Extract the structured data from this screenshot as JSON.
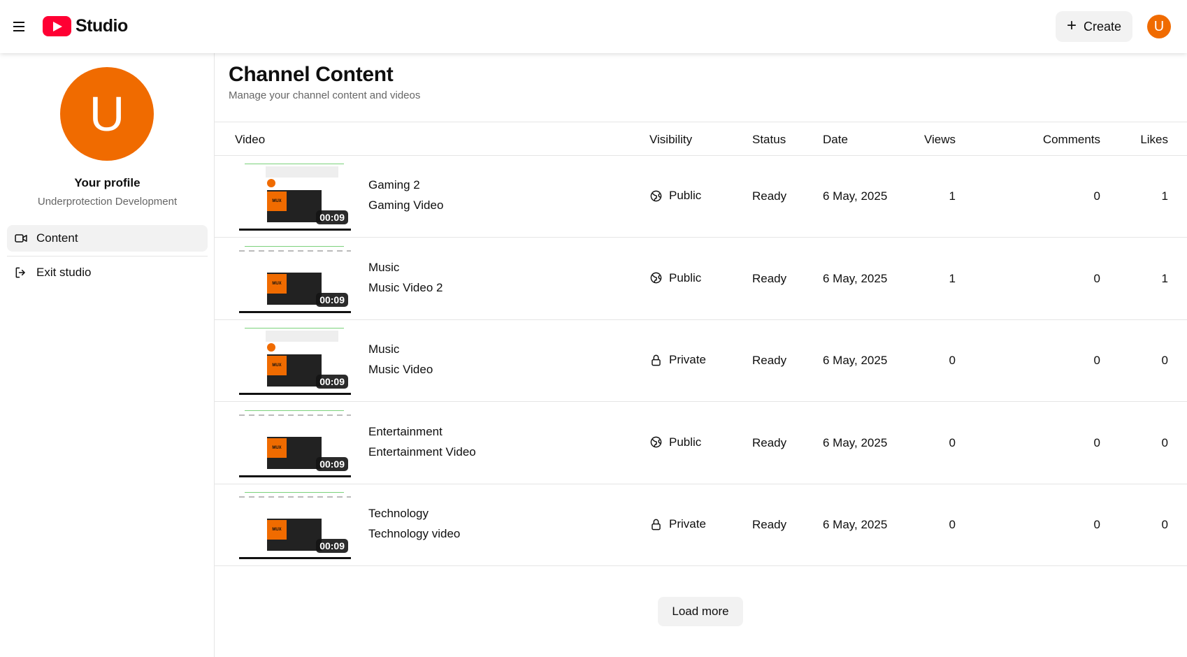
{
  "header": {
    "menu_icon": "hamburger-icon",
    "logo_text": "Studio",
    "create_label": "Create",
    "avatar_initial": "U"
  },
  "sidebar": {
    "avatar_initial": "U",
    "profile_title": "Your profile",
    "profile_name": "Underprotection Development",
    "items": [
      {
        "label": "Content",
        "icon": "video-camera-icon",
        "active": true
      },
      {
        "label": "Exit studio",
        "icon": "logout-icon",
        "active": false
      }
    ]
  },
  "main": {
    "title": "Channel Content",
    "subtitle": "Manage your channel content and videos",
    "columns": {
      "video": "Video",
      "visibility": "Visibility",
      "status": "Status",
      "date": "Date",
      "views": "Views",
      "comments": "Comments",
      "likes": "Likes"
    },
    "rows": [
      {
        "line1": "Gaming 2",
        "line2": "Gaming Video",
        "duration": "00:09",
        "visibility": "Public",
        "status": "Ready",
        "date": "6 May, 2025",
        "views": "1",
        "comments": "0",
        "likes": "1"
      },
      {
        "line1": "Music",
        "line2": "Music Video 2",
        "duration": "00:09",
        "visibility": "Public",
        "status": "Ready",
        "date": "6 May, 2025",
        "views": "1",
        "comments": "0",
        "likes": "1"
      },
      {
        "line1": "Music",
        "line2": "Music Video",
        "duration": "00:09",
        "visibility": "Private",
        "status": "Ready",
        "date": "6 May, 2025",
        "views": "0",
        "comments": "0",
        "likes": "0"
      },
      {
        "line1": "Entertainment",
        "line2": "Entertainment Video",
        "duration": "00:09",
        "visibility": "Public",
        "status": "Ready",
        "date": "6 May, 2025",
        "views": "0",
        "comments": "0",
        "likes": "0"
      },
      {
        "line1": "Technology",
        "line2": "Technology video",
        "duration": "00:09",
        "visibility": "Private",
        "status": "Ready",
        "date": "6 May, 2025",
        "views": "0",
        "comments": "0",
        "likes": "0"
      }
    ],
    "load_more_label": "Load more"
  },
  "colors": {
    "accent": "#f06b00",
    "logo_red": "#ff0033"
  }
}
